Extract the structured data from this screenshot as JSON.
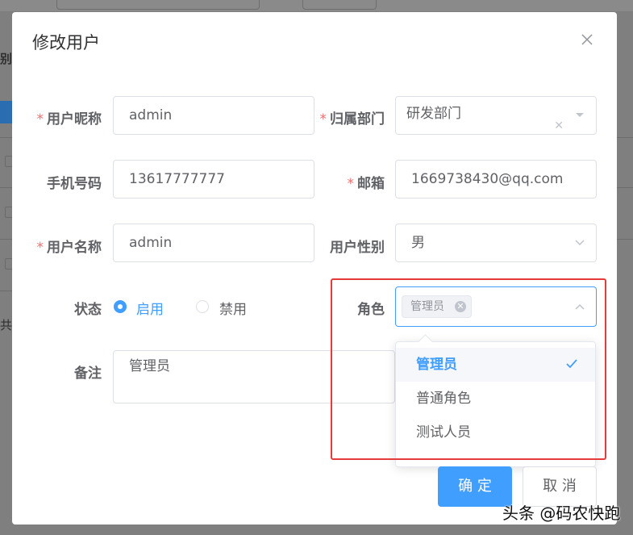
{
  "background": {
    "left_text_1": "别",
    "left_text_2": "共"
  },
  "dialog": {
    "title": "修改用户"
  },
  "form": {
    "required_mark": "*",
    "nickname": {
      "label": "用户昵称",
      "value": "admin"
    },
    "department": {
      "label": "归属部门",
      "value": "研发部门"
    },
    "phone": {
      "label": "手机号码",
      "value": "13617777777"
    },
    "email": {
      "label": "邮箱",
      "value": "1669738430@qq.com"
    },
    "username": {
      "label": "用户名称",
      "value": "admin"
    },
    "gender": {
      "label": "用户性别",
      "value": "男"
    },
    "status": {
      "label": "状态",
      "options": [
        {
          "label": "启用",
          "checked": true
        },
        {
          "label": "禁用",
          "checked": false
        }
      ]
    },
    "role": {
      "label": "角色",
      "selected_tags": [
        "管理员"
      ],
      "options": [
        {
          "label": "管理员",
          "selected": true
        },
        {
          "label": "普通角色",
          "selected": false
        },
        {
          "label": "测试人员",
          "selected": false
        }
      ]
    },
    "remark": {
      "label": "备注",
      "value": "管理员"
    }
  },
  "footer": {
    "confirm_label": "确 定",
    "cancel_label": "取 消"
  },
  "watermark": "头条 @码农快跑",
  "colors": {
    "primary": "#409eff",
    "required": "#f56c6c",
    "highlight": "#e63b3b"
  }
}
